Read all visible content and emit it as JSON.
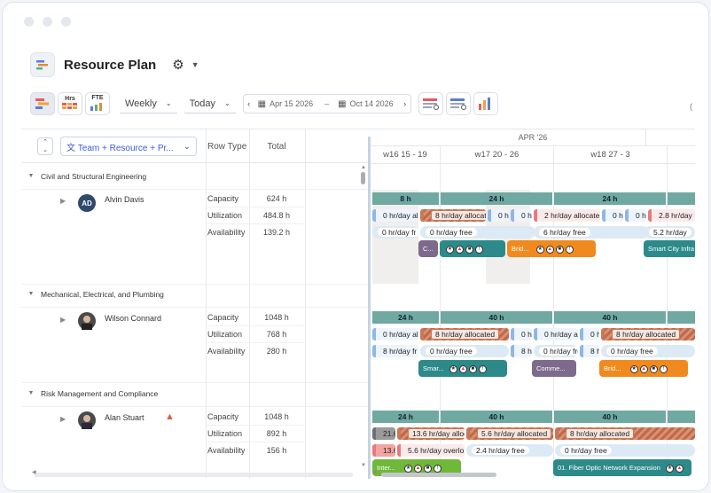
{
  "app": {
    "title": "Resource Plan"
  },
  "toolbar": {
    "hrs_label": "Hrs",
    "fte_label": "FTE",
    "view_select": "Weekly",
    "today_select": "Today",
    "start_date": "Apr 15 2026",
    "end_date": "Oct 14 2026",
    "range_sep": "–"
  },
  "grid": {
    "group_select": "Team + Resource + Pr...",
    "col_row_type": "Row Type",
    "col_total": "Total"
  },
  "timeline": {
    "month": "APR '26",
    "weeks": [
      "w16 15 - 19",
      "w17 20 - 26",
      "w18 27 - 3"
    ]
  },
  "teams": [
    {
      "name": "Civil and Structural Engineering",
      "resource": {
        "name": "Alvin Davis",
        "initials": "AD",
        "rows": [
          {
            "type": "Capacity",
            "total": "624 h"
          },
          {
            "type": "Utilization",
            "total": "484.8 h"
          },
          {
            "type": "Availability",
            "total": "139.2 h"
          }
        ]
      },
      "capacity": [
        "8 h",
        "24 h",
        "24 h"
      ],
      "utilization": [
        "0 hr/day al",
        "8 hr/day allocate",
        "0 hr",
        "0 hr",
        "2 hr/day allocate",
        "0 hr",
        "0 hr",
        "2.8 hr/day"
      ],
      "availability": [
        "0 hr/day fr",
        "0 hr/day free",
        "6 hr/day free",
        "5.2 hr/day"
      ],
      "chips": [
        "C...",
        "Brid...",
        "Smart City Infra"
      ]
    },
    {
      "name": "Mechanical, Electrical, and Plumbing",
      "resource": {
        "name": "Wilson Connard",
        "rows": [
          {
            "type": "Capacity",
            "total": "1048 h"
          },
          {
            "type": "Utilization",
            "total": "768 h"
          },
          {
            "type": "Availability",
            "total": "280 h"
          }
        ]
      },
      "capacity": [
        "24 h",
        "40 h",
        "40 h"
      ],
      "utilization": [
        "0 hr/day al",
        "8 hr/day allocated",
        "0 hr",
        "0 hr/day al",
        "0 hr",
        "8 hr/day allocated"
      ],
      "availability": [
        "8 hr/day fr",
        "0 hr/day free",
        "8 hr",
        "0 hr/day free",
        "8 hr",
        "0 hr/day free"
      ],
      "chips": [
        "Smar...",
        "Comme...",
        "Brid..."
      ]
    },
    {
      "name": "Risk Management and Compliance",
      "resource": {
        "name": "Alan Stuart",
        "rows": [
          {
            "type": "Capacity",
            "total": "1048 h"
          },
          {
            "type": "Utilization",
            "total": "892 h"
          },
          {
            "type": "Availability",
            "total": "156 h"
          }
        ]
      },
      "capacity": [
        "24 h",
        "40 h",
        "40 h"
      ],
      "utilization": [
        "21.6",
        "13.6 hr/day alloca",
        "5.6 hr/day allocated",
        "8 hr/day allocated"
      ],
      "availability": [
        "13.6",
        "5.6 hr/day overlo",
        "2.4 hr/day free",
        "0 hr/day free"
      ],
      "chips": [
        "Inter...",
        "01. Fiber Optic Network Expansion"
      ]
    }
  ],
  "colors": {
    "capacity_bar": "#6fa9a1",
    "chip_purple": "#7e6a8c",
    "chip_orange": "#f08a1e",
    "chip_teal": "#2c8a8a",
    "chip_green": "#6fb83a",
    "accent": "#3b5bdb"
  }
}
